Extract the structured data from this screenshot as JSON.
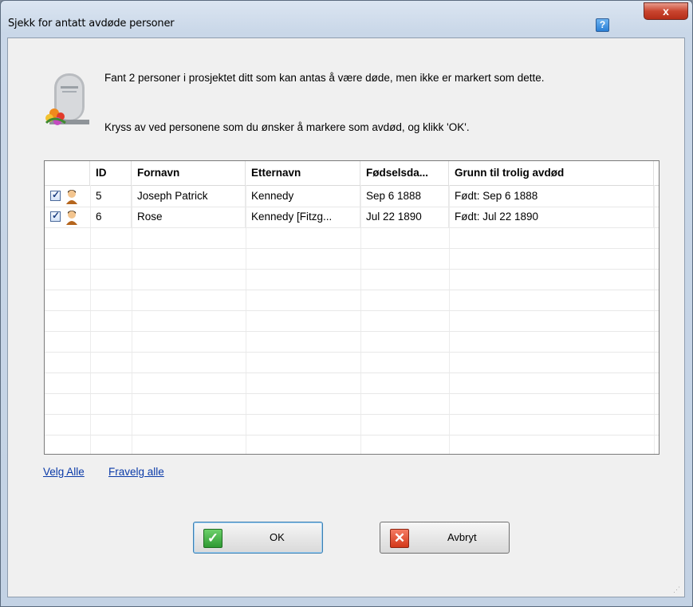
{
  "window": {
    "title": "Sjekk for antatt avdøde personer",
    "help_glyph": "?",
    "close_glyph": "x"
  },
  "message": {
    "line1": "Fant 2 personer i prosjektet ditt som kan antas å være døde, men ikke er markert som dette.",
    "line2": "Kryss av ved personene som du ønsker å markere som avdød, og klikk 'OK'."
  },
  "grid": {
    "columns": [
      "",
      "ID",
      "Fornavn",
      "Etternavn",
      "Fødselsda...",
      "Grunn til trolig avdød"
    ],
    "rows": [
      {
        "checked": true,
        "id": "5",
        "first": "Joseph Patrick",
        "last": "Kennedy",
        "birth": "Sep 6 1888",
        "reason": "Født: Sep 6 1888"
      },
      {
        "checked": true,
        "id": "6",
        "first": "Rose",
        "last": "Kennedy [Fitzg...",
        "birth": "Jul 22 1890",
        "reason": "Født: Jul 22 1890"
      }
    ]
  },
  "links": {
    "select_all": "Velg Alle",
    "deselect_all": "Fravelg alle"
  },
  "buttons": {
    "ok": "OK",
    "cancel": "Avbryt"
  },
  "icons": {
    "dialog": "tombstone-with-flowers-icon",
    "row": "person-icon",
    "ok": "checkmark-icon",
    "cancel": "x-mark-icon"
  },
  "colors": {
    "link": "#0a3aa8",
    "ok_icon": "#2f9a33",
    "cancel_icon": "#d33719",
    "close_button": "#c9452f"
  }
}
